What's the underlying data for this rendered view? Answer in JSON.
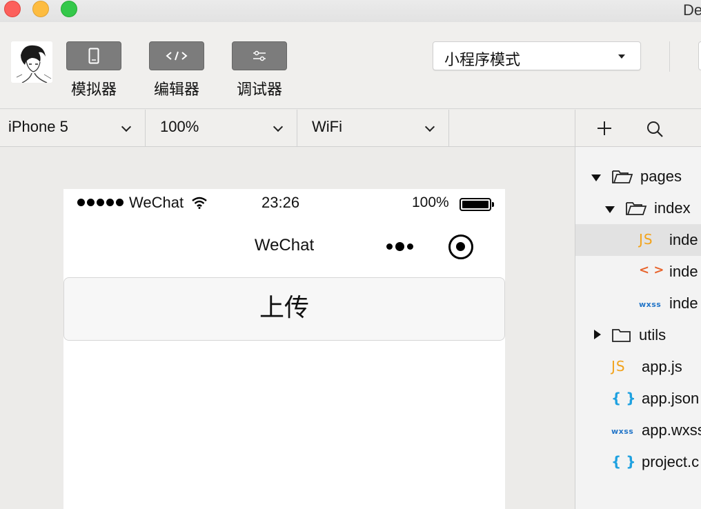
{
  "window": {
    "title": "De"
  },
  "toolbar": {
    "simulator_label": "模拟器",
    "editor_label": "编辑器",
    "debugger_label": "调试器",
    "mode": "小程序模式"
  },
  "device_bar": {
    "device": "iPhone 5",
    "zoom": "100%",
    "network": "WiFi"
  },
  "phone": {
    "carrier": "WeChat",
    "time": "23:26",
    "battery": "100%",
    "nav_title": "WeChat",
    "upload_label": "上传"
  },
  "file_tree": {
    "pages": "pages",
    "index_folder": "index",
    "index_js": "inde",
    "index_wxml": "inde",
    "index_wxss": "inde",
    "utils": "utils",
    "app_js": "app.js",
    "app_json": "app.json",
    "app_wxss": "app.wxss",
    "project": "project.c"
  },
  "icons": {
    "js": "JS",
    "tag": "< >",
    "wxss": "wxss",
    "json": "{ }"
  }
}
